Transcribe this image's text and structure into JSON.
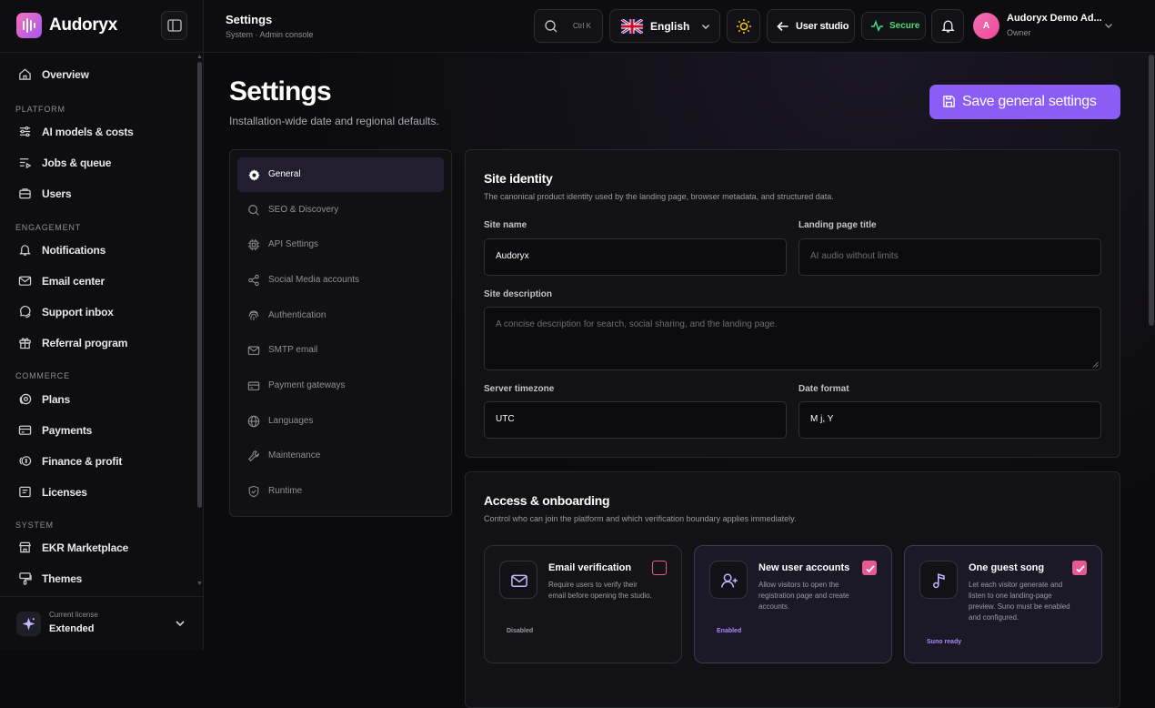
{
  "brand": {
    "name": "Audoryx"
  },
  "sidebar": {
    "items": [
      {
        "label": "Overview",
        "icon": "home-icon"
      },
      {
        "label": "AI models & costs",
        "icon": "sliders-icon"
      },
      {
        "label": "Jobs & queue",
        "icon": "list-play-icon"
      },
      {
        "label": "Users",
        "icon": "briefcase-icon"
      },
      {
        "label": "Notifications",
        "icon": "bell-icon"
      },
      {
        "label": "Email center",
        "icon": "mail-icon"
      },
      {
        "label": "Support inbox",
        "icon": "chat-icon"
      },
      {
        "label": "Referral program",
        "icon": "gift-icon"
      },
      {
        "label": "Plans",
        "icon": "plans-icon"
      },
      {
        "label": "Payments",
        "icon": "card-icon"
      },
      {
        "label": "Finance & profit",
        "icon": "coins-icon"
      },
      {
        "label": "Licenses",
        "icon": "license-icon"
      },
      {
        "label": "EKR Marketplace",
        "icon": "store-icon"
      },
      {
        "label": "Themes",
        "icon": "paint-icon"
      }
    ],
    "sections": [
      "PLATFORM",
      "ENGAGEMENT",
      "COMMERCE",
      "SYSTEM"
    ],
    "license": {
      "caption": "Current license",
      "value": "Extended"
    }
  },
  "header": {
    "title": "Settings",
    "subtitle": "System · Admin console",
    "search_shortcut": "Ctrl K",
    "language": "English",
    "user_studio": "User studio",
    "secure": "Secure",
    "user": {
      "initial": "A",
      "name": "Audoryx Demo Ad...",
      "role": "Owner"
    }
  },
  "page": {
    "title": "Settings",
    "subtitle": "Installation-wide date and regional defaults.",
    "save_label": "Save general settings"
  },
  "settings_nav": [
    {
      "label": "General",
      "icon": "gear-icon",
      "active": true
    },
    {
      "label": "SEO & Discovery",
      "icon": "search-icon"
    },
    {
      "label": "API Settings",
      "icon": "chip-icon"
    },
    {
      "label": "Social Media accounts",
      "icon": "share-icon"
    },
    {
      "label": "Authentication",
      "icon": "fingerprint-icon"
    },
    {
      "label": "SMTP email",
      "icon": "mail-icon"
    },
    {
      "label": "Payment gateways",
      "icon": "wallet-icon"
    },
    {
      "label": "Languages",
      "icon": "globe-icon"
    },
    {
      "label": "Maintenance",
      "icon": "wrench-icon"
    },
    {
      "label": "Runtime",
      "icon": "shield-icon"
    }
  ],
  "identity": {
    "title": "Site identity",
    "description": "The canonical product identity used by the landing page, browser metadata, and structured data.",
    "site_name_label": "Site name",
    "site_name_value": "Audoryx",
    "landing_title_label": "Landing page title",
    "landing_title_placeholder": "AI audio without limits",
    "site_description_label": "Site description",
    "site_description_placeholder": "A concise description for search, social sharing, and the landing page.",
    "timezone_label": "Server timezone",
    "timezone_value": "UTC",
    "date_format_label": "Date format",
    "date_format_value": "M j, Y"
  },
  "access": {
    "title": "Access & onboarding",
    "description": "Control who can join the platform and which verification boundary applies immediately.",
    "tiles": [
      {
        "name": "Email verification",
        "desc": "Require users to verify their email before opening the studio.",
        "status": "Disabled",
        "checked": false,
        "icon": "mail-icon"
      },
      {
        "name": "New user accounts",
        "desc": "Allow visitors to open the registration page and create accounts.",
        "status": "Enabled",
        "checked": true,
        "icon": "user-plus-icon"
      },
      {
        "name": "One guest song",
        "desc": "Let each visitor generate and listen to one landing-page preview. Suno must be enabled and configured.",
        "status": "Suno ready",
        "checked": true,
        "icon": "music-note-icon"
      }
    ]
  },
  "colors": {
    "accent": "#8b5cf6",
    "checkbox": "#e35b92",
    "secure": "#4ade80"
  }
}
